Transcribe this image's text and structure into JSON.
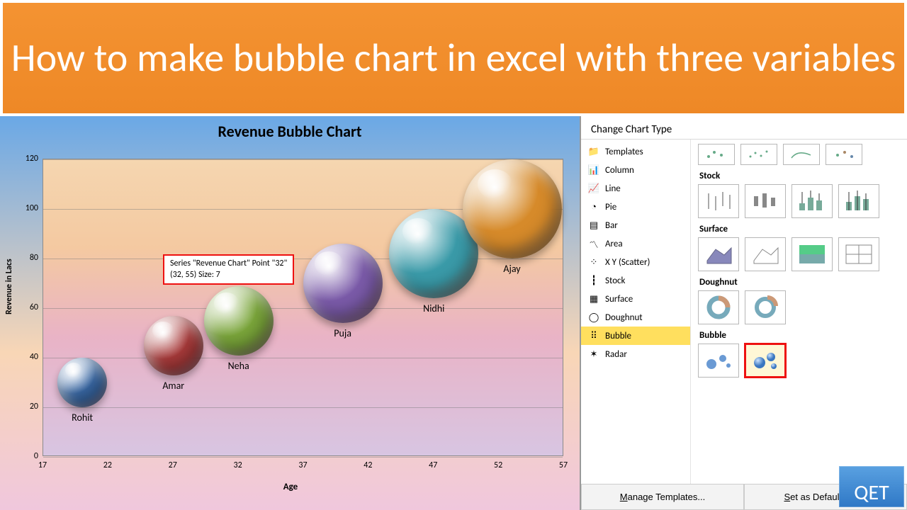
{
  "banner": {
    "title": "How to make bubble chart in excel with three variables"
  },
  "chart_data": {
    "type": "bubble",
    "title": "Revenue Bubble Chart",
    "xlabel": "Age",
    "ylabel": "Revenue in Lacs",
    "xlim": [
      17,
      57
    ],
    "ylim": [
      0,
      120
    ],
    "x_ticks": [
      17,
      22,
      27,
      32,
      37,
      42,
      47,
      52,
      57
    ],
    "y_ticks": [
      0,
      20,
      40,
      60,
      80,
      100,
      120
    ],
    "series_name": "Revenue Chart",
    "points": [
      {
        "name": "Rohit",
        "x": 20,
        "y": 30,
        "size": 5,
        "color": "#3a6aa8"
      },
      {
        "name": "Amar",
        "x": 27,
        "y": 45,
        "size": 6,
        "color": "#a83a3a"
      },
      {
        "name": "Neha",
        "x": 32,
        "y": 55,
        "size": 7,
        "color": "#7aa53a"
      },
      {
        "name": "Puja",
        "x": 40,
        "y": 70,
        "size": 8,
        "color": "#7a5aa8"
      },
      {
        "name": "Nidhi",
        "x": 47,
        "y": 82,
        "size": 9,
        "color": "#3a9aa8"
      },
      {
        "name": "Ajay",
        "x": 53,
        "y": 100,
        "size": 10,
        "color": "#d68a2a"
      }
    ],
    "tooltip": {
      "line1": "Series \"Revenue Chart\" Point \"32\"",
      "line2": "(32, 55) Size: 7"
    }
  },
  "panel": {
    "title": "Change Chart Type",
    "types": [
      "Templates",
      "Column",
      "Line",
      "Pie",
      "Bar",
      "Area",
      "X Y (Scatter)",
      "Stock",
      "Surface",
      "Doughnut",
      "Bubble",
      "Radar"
    ],
    "selected_type": "Bubble",
    "sections": {
      "top_row": "",
      "stock": "Stock",
      "surface": "Surface",
      "doughnut": "Doughnut",
      "bubble": "Bubble"
    },
    "footer": {
      "manage": "Manage Templates...",
      "set_default": "Set as Default Chart"
    }
  },
  "watermark": "QET"
}
